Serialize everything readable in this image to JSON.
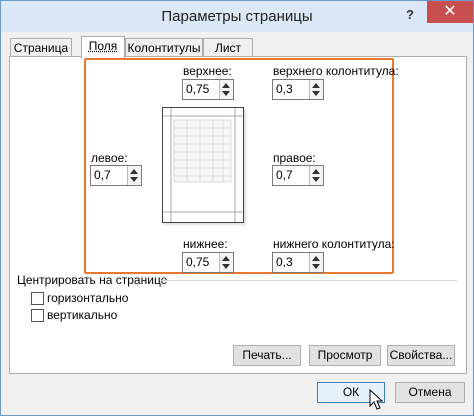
{
  "window": {
    "title": "Параметры страницы",
    "help": "?",
    "close": "✕"
  },
  "tabs": [
    "Страница",
    "Поля",
    "Колонтитулы",
    "Лист"
  ],
  "margins": {
    "top_label": "верхнее:",
    "top_value": "0,75",
    "header_label": "верхнего колонтитула:",
    "header_value": "0,3",
    "left_label": "левое:",
    "left_value": "0,7",
    "right_label": "правое:",
    "right_value": "0,7",
    "bottom_label": "нижнее:",
    "bottom_value": "0,75",
    "footer_label": "нижнего колонтитула:",
    "footer_value": "0,3"
  },
  "center": {
    "title": "Центрировать на странице",
    "horizontal": "горизонтально",
    "vertical": "вертикально"
  },
  "buttons": {
    "print": "Печать...",
    "preview": "Просмотр",
    "options": "Свойства...",
    "ok": "ОК",
    "cancel": "Отмена"
  },
  "colors": {
    "highlight": "#e8782c",
    "close_bg": "#c74f50",
    "title_bg": "#dae8f7"
  }
}
